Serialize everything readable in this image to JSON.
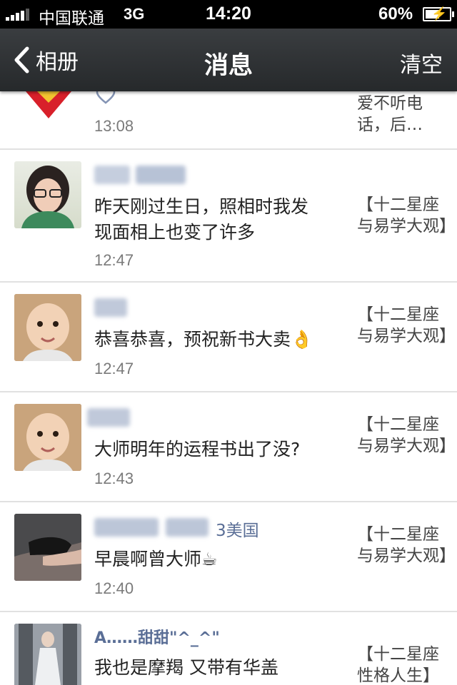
{
  "status": {
    "carrier": "中国联通",
    "network": "3G",
    "time": "14:20",
    "battery": "60%",
    "battery_level": 0.6
  },
  "nav": {
    "back_label": "相册",
    "title": "消息",
    "clear_label": "清空"
  },
  "messages": [
    {
      "name": "",
      "text": "",
      "time": "13:08",
      "ref": "爱不听电话，后…",
      "avatar": "red-diamond-image",
      "icon": "heart-icon"
    },
    {
      "name": "",
      "text": "昨天刚过生日，照相时我发现面相上也变了许多",
      "time": "12:47",
      "ref": "【十二星座与易学大观】",
      "avatar": "woman-glasses-photo"
    },
    {
      "name": "",
      "text": "恭喜恭喜，预祝新书大卖👌",
      "time": "12:47",
      "ref": "【十二星座与易学大观】",
      "avatar": "baby-photo"
    },
    {
      "name": "",
      "text": "大师明年的运程书出了没?",
      "time": "12:43",
      "ref": "【十二星座与易学大观】",
      "avatar": "baby-photo"
    },
    {
      "name": "3美国",
      "text": "早晨啊曾大师☕",
      "time": "12:40",
      "ref": "【十二星座与易学大观】",
      "avatar": "shoe-photo"
    },
    {
      "name": "A……甜甜\"^_^\"",
      "text": "我也是摩羯 又带有华盖",
      "time": "",
      "ref": "【十二星座性格人生】",
      "avatar": "woman-window-photo"
    }
  ]
}
